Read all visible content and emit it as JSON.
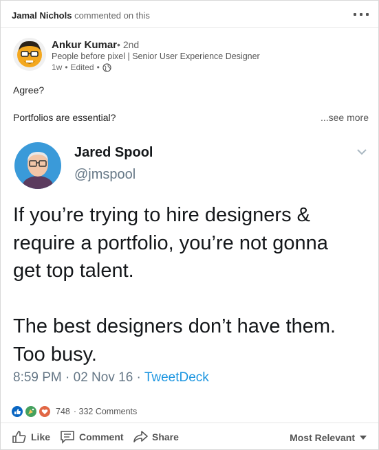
{
  "activity": {
    "actor": "Jamal Nichols",
    "action": "commented on this"
  },
  "post": {
    "author_name": "Ankur Kumar",
    "degree": "• 2nd",
    "headline": "People before pixel | Senior User Experience Designer",
    "time": "1w",
    "edited": "Edited",
    "text_line1": "Agree?",
    "text_line2": "Portfolios are essential?",
    "see_more": "...see more"
  },
  "tweet": {
    "name": "Jared Spool",
    "handle": "@jmspool",
    "body": "If you’re trying to hire designers &\nrequire a portfolio, you’re not gonna\nget top talent.\n\nThe best designers don’t have them.\nToo busy.",
    "timestamp": "8:59 PM · 02 Nov 16 · ",
    "source": "TweetDeck"
  },
  "social": {
    "reactions": "748",
    "comments": "· 332 Comments"
  },
  "actions": {
    "like": "Like",
    "comment": "Comment",
    "share": "Share",
    "sort": "Most Relevant"
  },
  "colors": {
    "link": "#1b95e0",
    "like_blue": "#0a66c2",
    "celebrate_green": "#44a15e",
    "love_red": "#e16745"
  },
  "icons": [
    "more-dots-icon",
    "globe-icon",
    "chevron-down-icon",
    "like-icon",
    "comment-icon",
    "share-icon",
    "like-reaction-icon",
    "celebrate-reaction-icon",
    "love-reaction-icon",
    "sort-caret-icon"
  ]
}
